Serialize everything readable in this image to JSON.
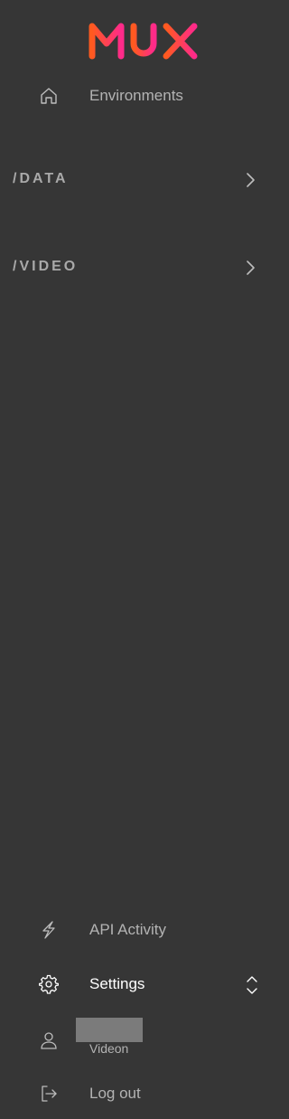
{
  "brand": {
    "logo_text": "MUX"
  },
  "nav": {
    "environments": {
      "label": "Environments",
      "icon": "home-icon"
    }
  },
  "sections": [
    {
      "label": "/DATA",
      "icon": "chevron-right-icon"
    },
    {
      "label": "/VIDEO",
      "icon": "chevron-right-icon"
    }
  ],
  "bottom": {
    "api_activity": {
      "label": "API Activity",
      "icon": "lightning-icon"
    },
    "settings": {
      "label": "Settings",
      "icon": "gear-icon",
      "toggle_icon": "chevron-up-down-icon"
    },
    "user": {
      "org": "Videon",
      "icon": "user-icon"
    },
    "logout": {
      "label": "Log out",
      "icon": "logout-icon"
    }
  },
  "colors": {
    "background": "#363636",
    "logo_gradient_start": "#ff6a00",
    "logo_gradient_end": "#ff2a8a"
  }
}
